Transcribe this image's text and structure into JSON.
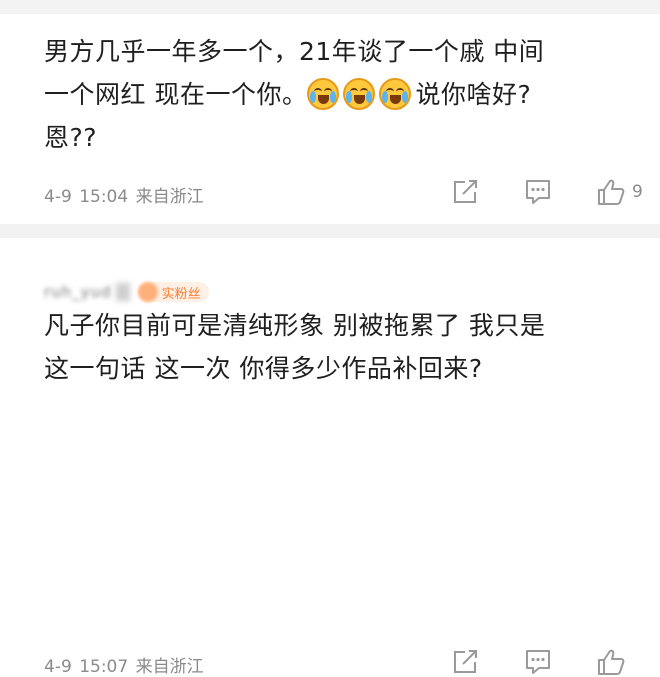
{
  "comments": [
    {
      "text_line1": "男方几乎一年多一个，21年谈了一个戚 中间",
      "text_line2_before": "一个网红 现在一个你。",
      "emoji_name": "laugh-cry-emoji",
      "text_line2_after": "说你啥好?",
      "text_line3": "恩??",
      "date": "4-9",
      "time": "15:04",
      "location": "来自浙江",
      "likes": "9"
    },
    {
      "username": "ruh_yud",
      "fan_badge": "实粉丝",
      "text_line1": "凡子你目前可是清纯形象 别被拖累了 我只是",
      "text_line2": "这一句话 这一次 你得多少作品补回来?",
      "date": "4-9",
      "time": "15:07",
      "location": "来自浙江"
    }
  ],
  "icons": {
    "share": "share-icon",
    "comment": "comment-icon",
    "like": "thumbs-up-icon",
    "emoji": "laugh-cry-emoji"
  },
  "colors": {
    "text": "#1f1f1f",
    "meta": "#8a8a8a",
    "divider": "#f2f2f2",
    "emoji_face": "#ffc83d",
    "fan_badge": "#ff7a2e"
  }
}
